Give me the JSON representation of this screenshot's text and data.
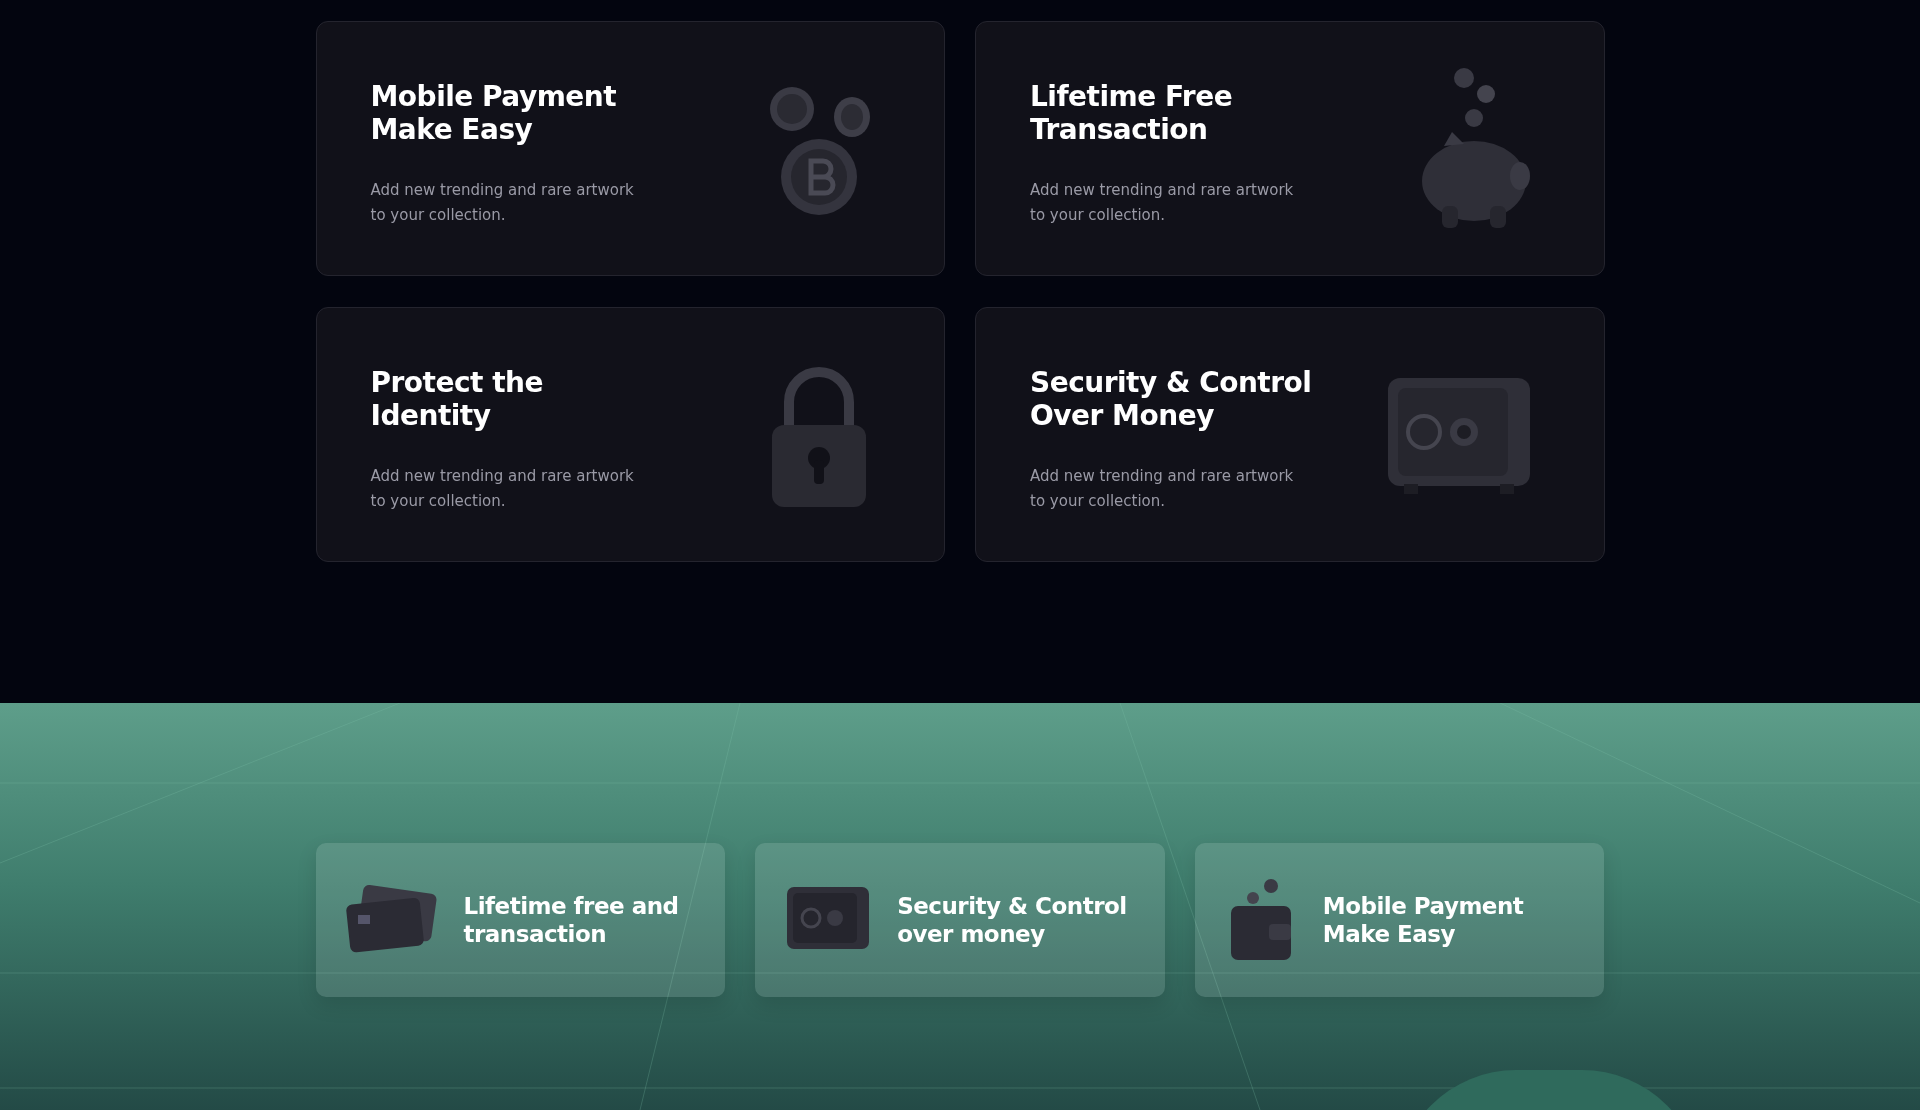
{
  "features": [
    {
      "kind": "coins",
      "title": [
        "Mobile Payment",
        "Make Easy"
      ],
      "description": [
        "Add new trending and rare artwork",
        "to your collection."
      ]
    },
    {
      "kind": "piggy",
      "title": [
        "Lifetime Free",
        "Transaction"
      ],
      "description": [
        "Add new trending and rare artwork",
        "to your collection."
      ]
    },
    {
      "kind": "lock",
      "title": [
        "Protect the",
        "Identity"
      ],
      "description": [
        "Add new trending and rare artwork",
        "to your collection."
      ]
    },
    {
      "kind": "safe",
      "title": [
        "Security & Control",
        "Over Money"
      ],
      "description": [
        "Add new trending and rare artwork",
        "to your collection."
      ]
    }
  ],
  "highlights": [
    {
      "kind": "cards",
      "title": [
        "Lifetime free and",
        "transaction"
      ]
    },
    {
      "kind": "safe",
      "title": [
        "Security & Control",
        "over money"
      ]
    },
    {
      "kind": "wallet",
      "title": [
        "Mobile Payment",
        "Make Easy"
      ]
    }
  ]
}
